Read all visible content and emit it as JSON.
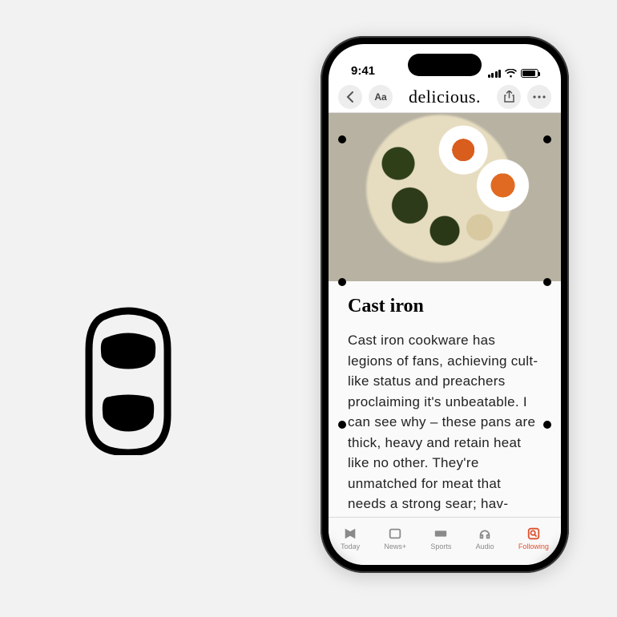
{
  "status": {
    "time": "9:41"
  },
  "header": {
    "app_title": "delicious"
  },
  "article": {
    "title": "Cast iron",
    "body": "Cast iron cookware has legions of fans, achieving cult-like status and preachers proclaiming it's unbeatable. I can see why – these pans are thick, heavy and retain heat like no other. They're unmatched for meat that needs a strong sear; hav-"
  },
  "tabs": [
    {
      "label": "Today"
    },
    {
      "label": "News+"
    },
    {
      "label": "Sports"
    },
    {
      "label": "Audio"
    },
    {
      "label": "Following"
    }
  ]
}
